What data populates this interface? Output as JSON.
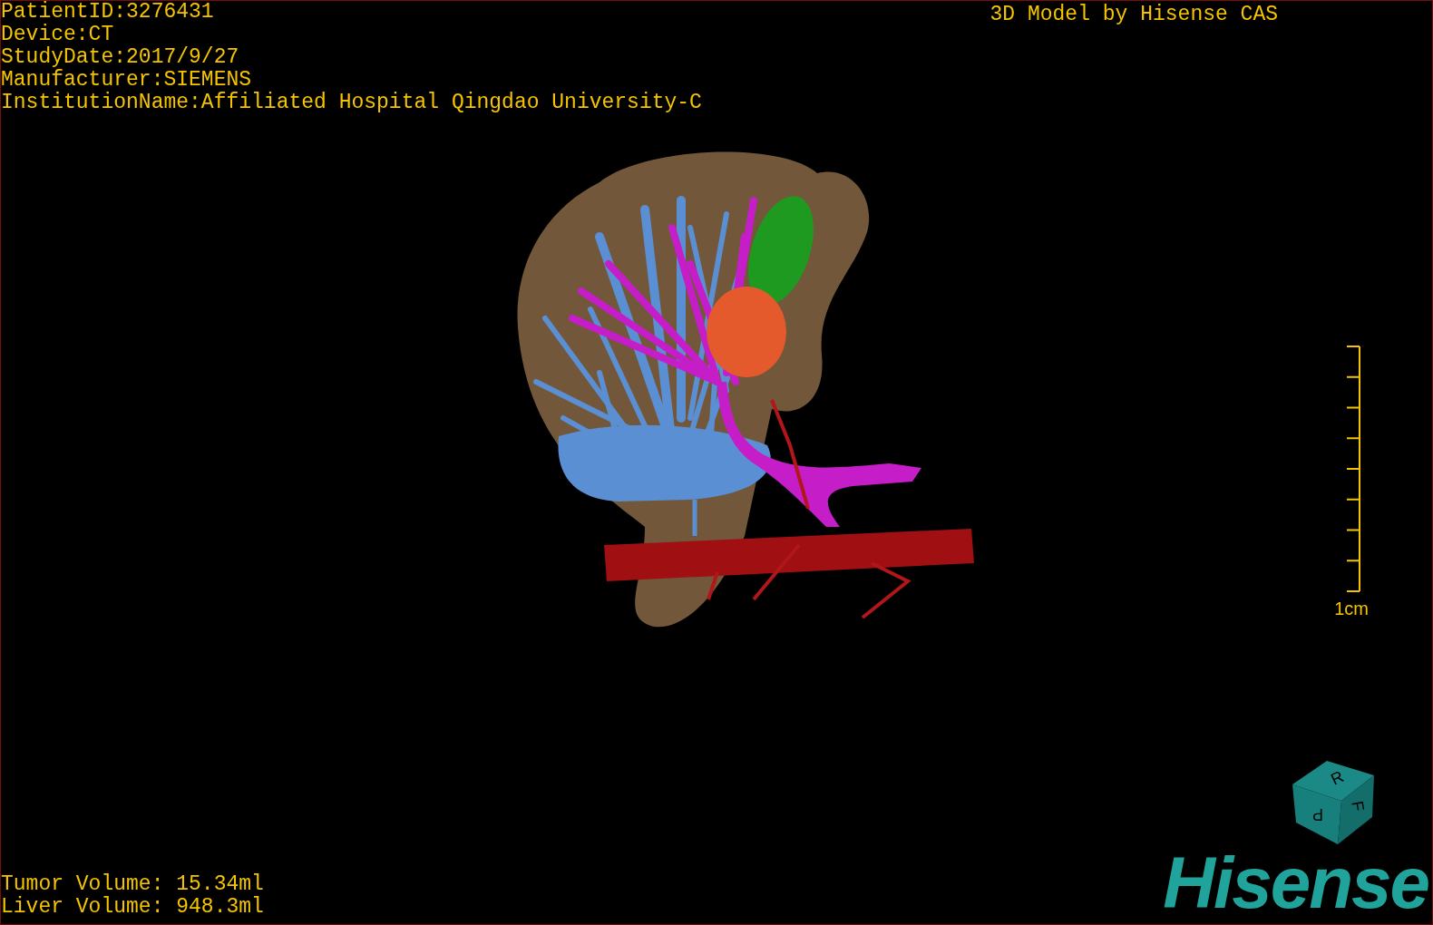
{
  "study_info": [
    "PatientID:3276431",
    "Device:CT",
    "StudyDate:2017/9/27",
    "Manufacturer:SIEMENS",
    "InstitutionName:Affiliated Hospital Qingdao University-C"
  ],
  "title": "3D Model by Hisense CAS",
  "scale_label": "1cm",
  "volumes": [
    "Tumor Volume: 15.34ml",
    "Liver Volume: 948.3ml"
  ],
  "orientation_cube": {
    "labels": [
      "R",
      "F",
      "P"
    ]
  },
  "logo": "Hisense"
}
